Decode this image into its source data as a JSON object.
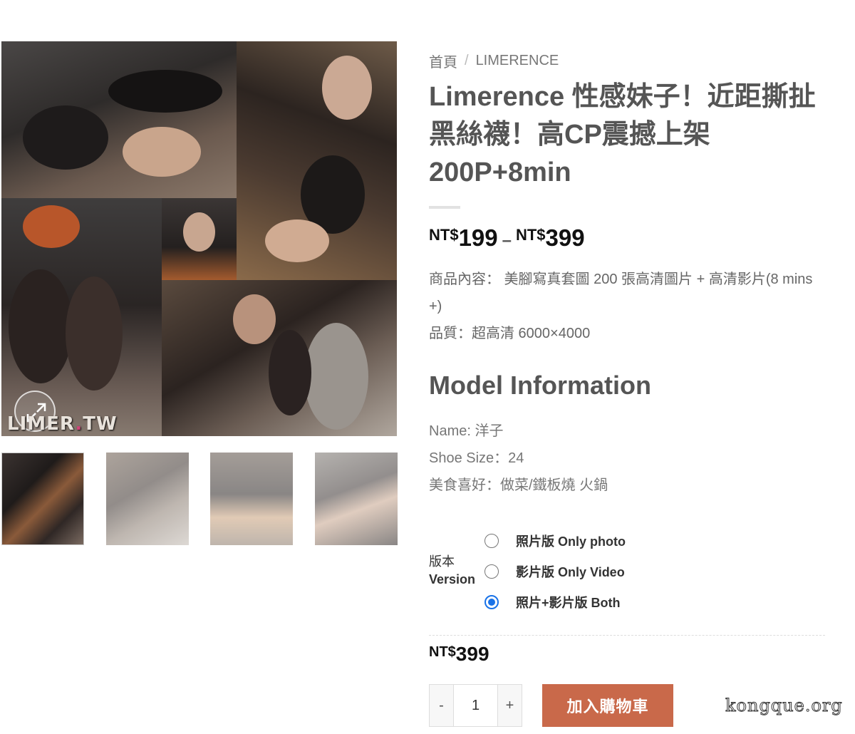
{
  "breadcrumb": {
    "home": "首頁",
    "separator": "/",
    "category": "LIMERENCE"
  },
  "product": {
    "title": "Limerence 性感妹子！近距撕扯黑絲襪！高CP震撼上架 200P+8min",
    "price_range": {
      "min_currency": "NT$",
      "min_amount": "199",
      "separator": "–",
      "max_currency": "NT$",
      "max_amount": "399"
    },
    "description_line1": "商品內容： 美腳寫真套圖 200 張高清圖片 + 高清影片(8 mins +)",
    "description_line2": "品質：超高清 6000×4000"
  },
  "model_info": {
    "heading": "Model Information",
    "name": "Name: 洋子",
    "shoe_size": "Shoe Size：24",
    "hobby": "美食喜好：做菜/鐵板燒 火鍋"
  },
  "variation": {
    "label_cn": "版本",
    "label_en": "Version",
    "options": [
      {
        "label": "照片版 Only photo",
        "checked": false
      },
      {
        "label": "影片版 Only Video",
        "checked": false
      },
      {
        "label": "照片+影片版 Both",
        "checked": true
      }
    ],
    "selected_price_currency": "NT$",
    "selected_price_amount": "399"
  },
  "cart": {
    "minus": "-",
    "quantity": "1",
    "plus": "+",
    "add_to_cart": "加入購物車"
  },
  "gallery": {
    "watermark_text": "LIMER",
    "watermark_dot": ".",
    "watermark_suffix": "TW"
  },
  "site_watermark": "kongque.org",
  "colors": {
    "accent_button": "#c9694a",
    "radio_checked": "#1a73e8",
    "price_text": "#111111",
    "body_text": "#555555"
  }
}
